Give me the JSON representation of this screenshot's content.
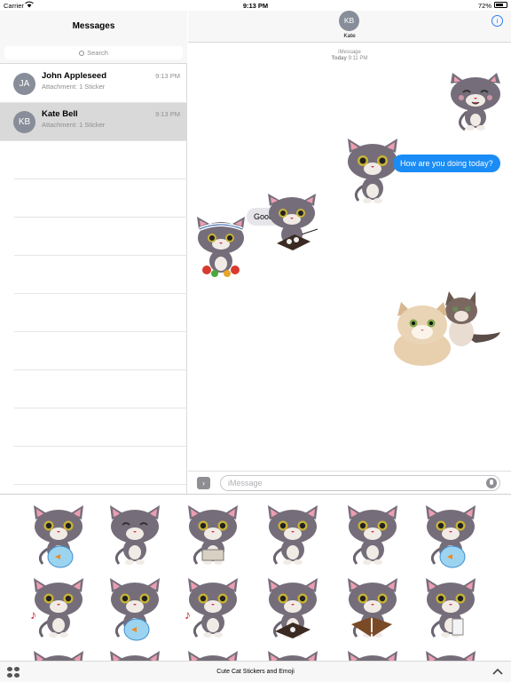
{
  "status_bar": {
    "carrier": "Carrier",
    "time": "9:13 PM",
    "battery": "72%",
    "battery_level": 0.72
  },
  "sidebar": {
    "title": "Messages",
    "search_placeholder": "Search",
    "conversations": [
      {
        "initials": "JA",
        "name": "John Appleseed",
        "time": "9:13 PM",
        "preview": "Attachment: 1 Sticker",
        "selected": false
      },
      {
        "initials": "KB",
        "name": "Kate Bell",
        "time": "9:13 PM",
        "preview": "Attachment: 1 Sticker",
        "selected": true
      }
    ]
  },
  "conversation": {
    "contact_initials": "KB",
    "contact_name": "Kate",
    "service": "iMessage",
    "timestamp_day": "Today",
    "timestamp_time": "9:11 PM",
    "outgoing_message": "How are you doing today?",
    "incoming_message": "Good",
    "input_placeholder": "iMessage",
    "colors": {
      "outgoing_bubble": "#1a8cf5",
      "incoming_bubble": "#e5e5ea",
      "link": "#2b7cf6"
    }
  },
  "sticker_drawer": {
    "title": "Cute Cat Stickers and Emoji",
    "stickers_row1": [
      "cat-fishbowl-sticker",
      "cat-happy-sticker",
      "cat-holding-box-sticker",
      "cat-worried-sticker",
      "cat-smiling-sticker",
      "cat-annoyed-sticker"
    ],
    "stickers_row2": [
      "cat-music-sticker",
      "cat-angry-sticker",
      "cat-music-fishbowl-sticker",
      "cat-sushi-sticker",
      "cat-eating-sticker",
      "cat-milk-sticker"
    ]
  }
}
